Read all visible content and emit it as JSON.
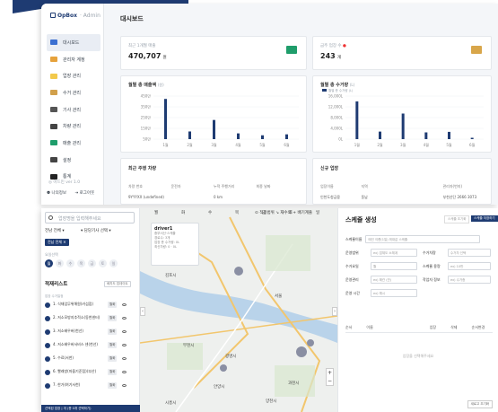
{
  "dashboard": {
    "brand": "OpBox",
    "brand_sub": "· Admin",
    "page_title": "대시보드",
    "nav": [
      "대시보드",
      "관리자 계정",
      "업장 관리",
      "수거 관리",
      "기사 관리",
      "차량 관리",
      "매출 관리",
      "설정",
      "통계"
    ],
    "nav_colors": [
      "#3b6fd1",
      "#e6a23c",
      "#f2c94c",
      "#d1a04b",
      "#555555",
      "#444444",
      "#1f9d6b",
      "#444444",
      "#222222"
    ],
    "sidebar_version": "◎ 어드민 ver 1.0",
    "sidebar_user": "나의정보",
    "sidebar_logout": "로그아웃",
    "card1_label": "최근 1개월 매출",
    "card1_value": "470,707",
    "card1_unit": "원",
    "card2_label": "금주 업장 수",
    "card2_value": "243",
    "card2_unit": "개",
    "chart1_title": "월별 총 매출액",
    "chart1_unit": "(원)",
    "chart2_title": "월별 총 수거량",
    "chart2_unit": "(L)",
    "chart2_legend": "월별 총 수거량 (L)",
    "table1_title": "최근 주행 차량",
    "table1_headers": [
      "차량 번호",
      "운전자",
      "누적 주행거리",
      "최종 날짜"
    ],
    "table1_row": [
      "9YYYXX (undefined)",
      "",
      "0 km",
      ""
    ],
    "table2_title": "신규 업장",
    "table2_headers": [
      "업장이름",
      "지역",
      "",
      "관리자(번지)"
    ],
    "table2_row": [
      "인천도청금융",
      "동남",
      "",
      "부천산단 2666 3073"
    ]
  },
  "chart_data": [
    {
      "type": "bar",
      "title": "월별 총 매출액",
      "ylabel": "(원)",
      "categories": [
        "1월",
        "2월",
        "3월",
        "4월",
        "5월",
        "6월"
      ],
      "ticks": [
        "450만",
        "350만",
        "250만",
        "150만",
        "50만"
      ],
      "values": [
        420,
        80,
        200,
        60,
        40,
        50
      ],
      "ylim": [
        0,
        450
      ]
    },
    {
      "type": "bar",
      "title": "월별 총 수거량",
      "ylabel": "(L)",
      "categories": [
        "1월",
        "2월",
        "3월",
        "4월",
        "5월",
        "6월"
      ],
      "ticks": [
        "16,000L",
        "12,000L",
        "8,000L",
        "4,000L",
        "0L"
      ],
      "series": [
        {
          "name": "월별 총 수거량 (L)",
          "values": [
            14000,
            2800,
            9500,
            2500,
            2700,
            500
          ]
        }
      ],
      "ylim": [
        0,
        16000
      ]
    }
  ],
  "scheduler": {
    "search_placeholder": "업장명을 입력해주세요",
    "region_select": "전남 전체",
    "manager_select": "담당기사 선택",
    "selected_tag": "전남 전체 ✕",
    "day_label": "요일선택",
    "days": [
      "월",
      "화",
      "수",
      "목",
      "금",
      "토",
      "일"
    ],
    "list_title": "적재리스트",
    "list_button": "배치도 업데이트",
    "list_subtitle": "업장 수거일정",
    "waypoints": [
      {
        "name": "1. 식재업무위해원(카섬점)",
        "pill": "월화"
      },
      {
        "name": "2. 저소모방지추적소(동천센터)",
        "pill": "월화"
      },
      {
        "name": "3. 저소배우버(천선)",
        "pill": "월화"
      },
      {
        "name": "4. 저소배우버서비스 센(천선)",
        "pill": "월화"
      },
      {
        "name": "5. 수료(서천)",
        "pill": "월화"
      },
      {
        "name": "6. 빨래방(마을기준점)(부산)",
        "pill": "월화"
      },
      {
        "name": "7. 한가(여기서천)",
        "pill": "월화"
      }
    ],
    "bottom_bar": "선택된 업장 | 개 (총 0개 선택하기)",
    "map_tabs": [
      "월",
      "화",
      "수",
      "목",
      "금",
      "토",
      "일"
    ],
    "map_tools": "⊙ 적용범위  ↘ 재수의  + 배기계출",
    "map_card_title": "driver1",
    "map_card_lines": [
      "중부서산·스케줄",
      "경로수: 3개",
      "업장 총 수거량: 0L",
      "최신차량: 0 · 0L"
    ],
    "map_labels": [
      "김포시",
      "부천시",
      "광명시",
      "안양시",
      "과천시",
      "시흥시",
      "서울",
      "양천시"
    ],
    "panel_title": "스케쥴 생성",
    "reset_button": "스케쥴 초기화",
    "save_button": "스케쥴 저장하기",
    "schedule_name_label": "스케쥴이름",
    "schedule_name_placeholder": "메인 이름(1일) 최대값 스케쥴",
    "rows": [
      {
        "l1": "운영범위",
        "v1": "ex) 업체도 소체계",
        "l2": "수거차량",
        "v2": "수거차 선택"
      },
      {
        "l1": "수거요일",
        "v1": "월",
        "l2": "스케쥴 용량",
        "v2": "ex) 10만"
      },
      {
        "l1": "운영관리",
        "v1": "ex) 해관 (관)",
        "l2": "작업자 정보",
        "v2": "ex) 수거종"
      },
      {
        "l1": "운영 시간",
        "v1": "ex) 예시",
        "l2": "",
        "v2": ""
      }
    ],
    "grid_headers": [
      "순서",
      "이름",
      "",
      "",
      "업장",
      "삭제",
      "순서변경"
    ],
    "grid_empty": "업장을 선택해주세요",
    "footer_button": "새로고 초기화"
  }
}
